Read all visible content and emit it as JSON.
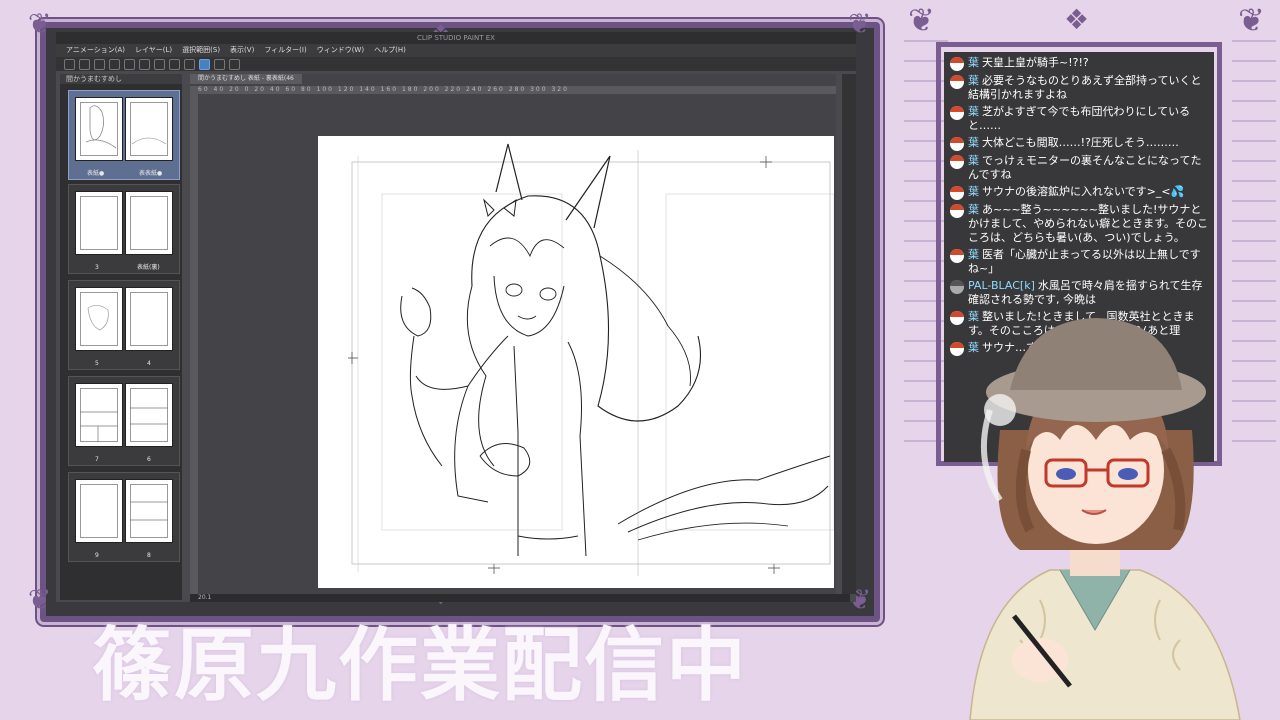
{
  "app": {
    "title": "CLIP STUDIO PAINT EX",
    "menu": [
      "アニメーション(A)",
      "レイヤー(L)",
      "選択範囲(S)",
      "表示(V)",
      "フィルター(I)",
      "ウィンドウ(W)",
      "ヘルプ(H)"
    ],
    "panel_tab": "間かうまむすめし",
    "doc_tab": "間かうまむすめし 表紙 - 裏表紙(46",
    "ruler_ticks": "60 40 20 0 20 40 60 80 100 120 140 160 180 200 220 240 260 280 300 320",
    "status_zoom": "20.1",
    "pages": [
      {
        "left": "表紙●",
        "right": "表表紙●"
      },
      {
        "left": "3",
        "right": "表紙(裏)"
      },
      {
        "left": "5",
        "right": "4"
      },
      {
        "left": "7",
        "right": "6"
      },
      {
        "left": "9",
        "right": "8"
      }
    ]
  },
  "chat": {
    "messages": [
      {
        "author": "葉",
        "text": "天皇上皇が騎手~!?!?"
      },
      {
        "author": "葉",
        "text": "必要そうなものとりあえず全部持っていくと結構引かれますよね"
      },
      {
        "author": "葉",
        "text": "芝がよすぎて今でも布団代わりにしていると……"
      },
      {
        "author": "葉",
        "text": "大体どこも閲取……!?圧死しそう………"
      },
      {
        "author": "葉",
        "text": "でっけぇモニターの裏そんなことになってたんですね"
      },
      {
        "author": "葉",
        "text": "サウナの後溶鉱炉に入れないです>_<💦"
      },
      {
        "author": "葉",
        "text": "あ~~~整う~~~~~~整いました!サウナとかけまして、やめられない癖とときます。そのこころは、どちらも暑い(あ、つい)でしょう。"
      },
      {
        "author": "葉",
        "text": "医者「心臓が止まってる以外は以上無しですね~」"
      },
      {
        "author": "PAL-BLAC[k]",
        "text": "水風呂で時々肩を揺すられて生存確認される勢です, 今晩は"
      },
      {
        "author": "葉",
        "text": "整いました!ときまして、国数英社とときます。そのこころは、どちらもあとり(あと理"
      },
      {
        "author": "葉",
        "text": "サウナ…す そのこ…で"
      }
    ]
  },
  "banner": {
    "text": "篠原九作業配信中"
  },
  "colors": {
    "background": "#e6d4ea",
    "frame": "#6d5384",
    "chat_author": "#8ed9ff"
  }
}
